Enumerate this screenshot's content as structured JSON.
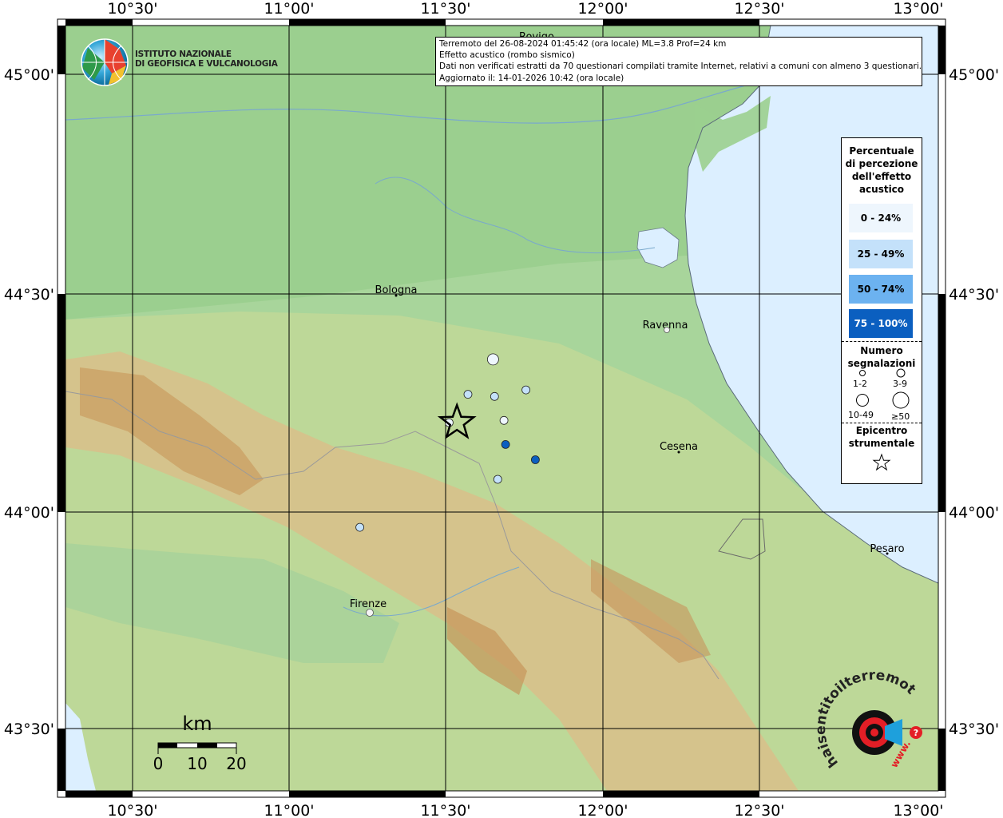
{
  "info": {
    "line1": "Terremoto del 26-08-2024 01:45:42 (ora locale) ML=3.8 Prof=24 km",
    "line2": "Effetto acustico (rombo sismico)",
    "line3": "Dati non verificati estratti da 70 questionari compilati tramite Internet, relativi a comuni con almeno 3 questionari.",
    "line4": "Aggiornato il: 14-01-2026 10:42 (ora locale)"
  },
  "logo": {
    "line1": "ISTITUTO NAZIONALE",
    "line2": "DI GEOFISICA E VULCANOLOGIA"
  },
  "lon_ticks": [
    "10°30'",
    "11°00'",
    "11°30'",
    "12°00'",
    "12°30'",
    "13°00'"
  ],
  "lat_ticks": [
    "45°00'",
    "44°30'",
    "44°00'",
    "43°30'"
  ],
  "cities": [
    {
      "name": "Rovigo"
    },
    {
      "name": "Bologna"
    },
    {
      "name": "Ravenna"
    },
    {
      "name": "Cesena"
    },
    {
      "name": "Pesaro"
    },
    {
      "name": "Firenze"
    }
  ],
  "legend": {
    "title_lines": [
      "Percentuale",
      "di percezione",
      "dell'effetto",
      "acustico"
    ],
    "classes": [
      {
        "label": "0 - 24%",
        "color": "#eef6fd"
      },
      {
        "label": "25 - 49%",
        "color": "#c4e1fa"
      },
      {
        "label": "50 - 74%",
        "color": "#6cb2f0"
      },
      {
        "label": "75 - 100%",
        "color": "#0b5fc0"
      }
    ],
    "count_title_lines": [
      "Numero",
      "segnalazioni"
    ],
    "sizes": [
      "1-2",
      "3-9",
      "10-49",
      "≥50"
    ],
    "epicenter_title_lines": [
      "Epicentro",
      "strumentale"
    ]
  },
  "scalebar": {
    "unit": "km",
    "labels": [
      "0",
      "10",
      "20"
    ]
  },
  "watermark": {
    "text_a": "haisentitoilterremoto.it",
    "text_b": "www."
  },
  "observations": [
    {
      "lon": 11.65,
      "lat": 44.35,
      "class": 0,
      "size": 1
    },
    {
      "lon": 11.57,
      "lat": 44.27,
      "class": 1,
      "size": 0
    },
    {
      "lon": 11.655,
      "lat": 44.265,
      "class": 1,
      "size": 0
    },
    {
      "lon": 11.755,
      "lat": 44.28,
      "class": 1,
      "size": 0
    },
    {
      "lon": 11.685,
      "lat": 44.21,
      "class": 0,
      "size": 0
    },
    {
      "lon": 11.51,
      "lat": 44.205,
      "class": 0,
      "size": 0
    },
    {
      "lon": 11.69,
      "lat": 44.155,
      "class": 3,
      "size": 0
    },
    {
      "lon": 11.785,
      "lat": 44.12,
      "class": 3,
      "size": 0
    },
    {
      "lon": 11.665,
      "lat": 44.075,
      "class": 1,
      "size": 0
    },
    {
      "lon": 11.225,
      "lat": 43.965,
      "class": 1,
      "size": 0
    }
  ],
  "epicenter": {
    "lon": 11.535,
    "lat": 44.205
  },
  "colors": {
    "sea": "#dcefff",
    "plain": "#9fcf92",
    "hills": "#c7d79a",
    "mountains": "#d6b27a",
    "grid": "#000000"
  }
}
